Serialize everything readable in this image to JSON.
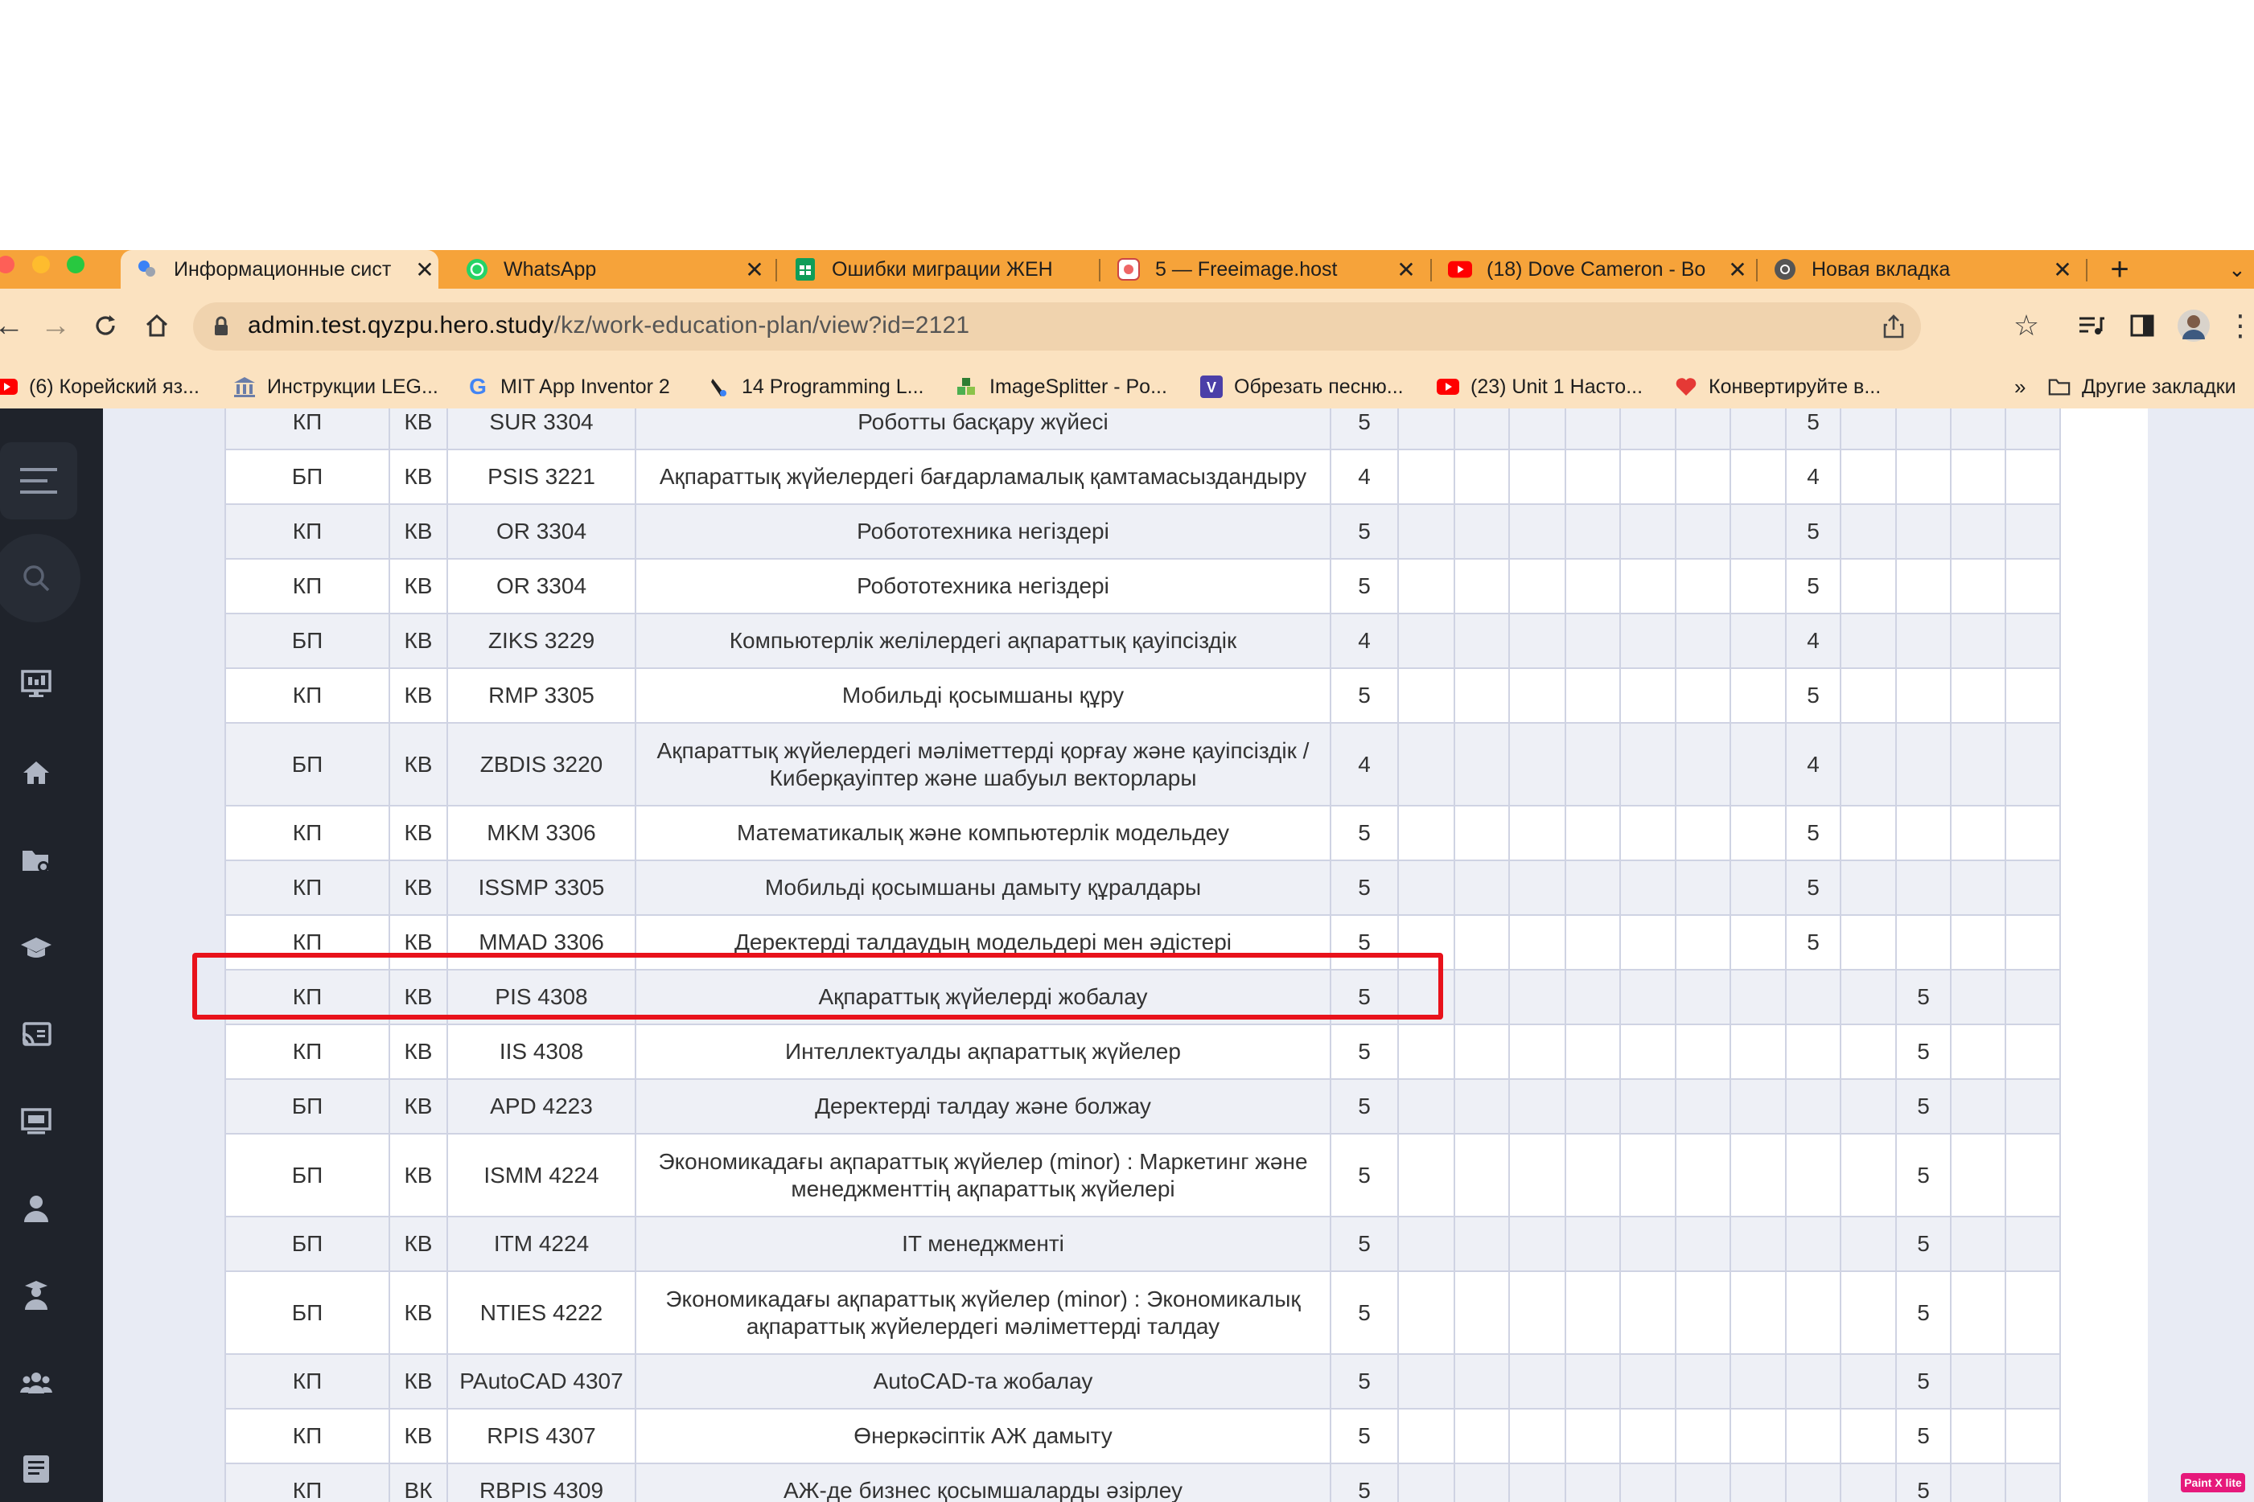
{
  "browser": {
    "tabs": [
      {
        "title": "Информационные сист",
        "icon": "hero-icon",
        "active": true
      },
      {
        "title": "WhatsApp",
        "icon": "whatsapp-icon"
      },
      {
        "title": "Ошибки миграции ЖЕН",
        "icon": "sheets-icon"
      },
      {
        "title": "5 — Freeimage.host",
        "icon": "freeimage-icon"
      },
      {
        "title": "(18) Dove Cameron - Bo",
        "icon": "youtube-icon"
      },
      {
        "title": "Новая вкладка",
        "icon": "chrome-icon"
      }
    ],
    "new_tab": "+",
    "url_domain": "admin.test.qyzpu.hero.study",
    "url_path": "/kz/work-education-plan/view?id=2121",
    "bookmarks": [
      {
        "label": "(6) Корейский яз...",
        "icon": "youtube-icon"
      },
      {
        "label": "Инструкции LEG...",
        "icon": "building-icon"
      },
      {
        "label": "MIT App Inventor 2",
        "icon": "google-icon"
      },
      {
        "label": "14 Programming L...",
        "icon": "pen-icon"
      },
      {
        "label": "ImageSplitter - Po...",
        "icon": "imagesplitter-icon"
      },
      {
        "label": "Обрезать песню...",
        "icon": "v-icon"
      },
      {
        "label": "(23) Unit 1 Насто...",
        "icon": "youtube-icon"
      },
      {
        "label": "Конвертируйте в...",
        "icon": "heart-icon"
      }
    ],
    "more_bookmarks": "»",
    "other_bookmarks": "Другие закладки"
  },
  "table": {
    "rows": [
      {
        "c1": "КП",
        "c2": "КВ",
        "code": "SUR 3304",
        "name": "Роботты басқару жүйесі",
        "credit": "5",
        "s": "5",
        "col": "a"
      },
      {
        "c1": "БП",
        "c2": "КВ",
        "code": "PSIS 3221",
        "name": "Ақпараттық жүйелердегі бағдарламалық қамтамасыздандыру",
        "credit": "4",
        "s": "4",
        "col": "a"
      },
      {
        "c1": "КП",
        "c2": "КВ",
        "code": "OR 3304",
        "name": "Робототехника негіздері",
        "credit": "5",
        "s": "5",
        "col": "a"
      },
      {
        "c1": "КП",
        "c2": "КВ",
        "code": "OR 3304",
        "name": "Робототехника негіздері",
        "credit": "5",
        "s": "5",
        "col": "a"
      },
      {
        "c1": "БП",
        "c2": "КВ",
        "code": "ZIKS 3229",
        "name": "Компьютерлік желілердегі ақпараттық қауіпсіздік",
        "credit": "4",
        "s": "4",
        "col": "a"
      },
      {
        "c1": "КП",
        "c2": "КВ",
        "code": "RMP 3305",
        "name": "Мобильді қосымшаны құру",
        "credit": "5",
        "s": "5",
        "col": "a"
      },
      {
        "c1": "БП",
        "c2": "КВ",
        "code": "ZBDIS 3220",
        "name": "Ақпараттық жүйелердегі мәліметтерді қорғау және қауіпсіздік / Киберқауіптер және шабуыл векторлары",
        "credit": "4",
        "s": "4",
        "col": "a",
        "tall": true
      },
      {
        "c1": "КП",
        "c2": "КВ",
        "code": "MKM 3306",
        "name": "Математикалық және компьютерлік модельдеу",
        "credit": "5",
        "s": "5",
        "col": "a"
      },
      {
        "c1": "КП",
        "c2": "КВ",
        "code": "ISSMP 3305",
        "name": "Мобильді қосымшаны дамыту құралдары",
        "credit": "5",
        "s": "5",
        "col": "a"
      },
      {
        "c1": "КП",
        "c2": "КВ",
        "code": "MMAD 3306",
        "name": "Деректерді талдаудың модельдері мен әдістері",
        "credit": "5",
        "s": "5",
        "col": "a"
      },
      {
        "c1": "КП",
        "c2": "КВ",
        "code": "PIS 4308",
        "name": "Ақпараттық жүйелерді жобалау",
        "credit": "5",
        "s": "5",
        "col": "b"
      },
      {
        "c1": "КП",
        "c2": "КВ",
        "code": "IIS 4308",
        "name": "Интеллектуалды ақпараттық жүйелер",
        "credit": "5",
        "s": "5",
        "col": "b"
      },
      {
        "c1": "БП",
        "c2": "КВ",
        "code": "APD 4223",
        "name": "Деректерді талдау және болжау",
        "credit": "5",
        "s": "5",
        "col": "b"
      },
      {
        "c1": "БП",
        "c2": "КВ",
        "code": "ISMM 4224",
        "name": "Экономикадағы ақпараттық жүйелер (minor) : Маркетинг және менеджменттің ақпараттық жүйелері",
        "credit": "5",
        "s": "5",
        "col": "b",
        "tall": true
      },
      {
        "c1": "БП",
        "c2": "КВ",
        "code": "ITM 4224",
        "name": "IT менеджменті",
        "credit": "5",
        "s": "5",
        "col": "b"
      },
      {
        "c1": "БП",
        "c2": "КВ",
        "code": "NTIES 4222",
        "name": "Экономикадағы ақпараттық жүйелер (minor) : Экономикалық ақпараттық жүйелердегі мәліметтерді талдау",
        "credit": "5",
        "s": "5",
        "col": "b",
        "tall": true
      },
      {
        "c1": "КП",
        "c2": "КВ",
        "code": "PAutoCAD 4307",
        "name": "AutoCAD-та жобалау",
        "credit": "5",
        "s": "5",
        "col": "b"
      },
      {
        "c1": "КП",
        "c2": "КВ",
        "code": "RPIS 4307",
        "name": "Өнеркәсіптік АЖ дамыту",
        "credit": "5",
        "s": "5",
        "col": "b"
      },
      {
        "c1": "КП",
        "c2": "ВК",
        "code": "RBPIS 4309",
        "name": "АЖ-де бизнес қосымшаларды әзірлеу",
        "credit": "5",
        "s": "5",
        "col": "b"
      }
    ]
  },
  "sidebar": {
    "items": [
      "menu-icon",
      "search-icon",
      "monitor-icon",
      "home-icon",
      "folder-icon",
      "graduation-icon",
      "cast-icon",
      "screen-icon",
      "user-icon",
      "student-icon",
      "group-icon",
      "document-icon"
    ]
  },
  "badge": "Paint X lite"
}
